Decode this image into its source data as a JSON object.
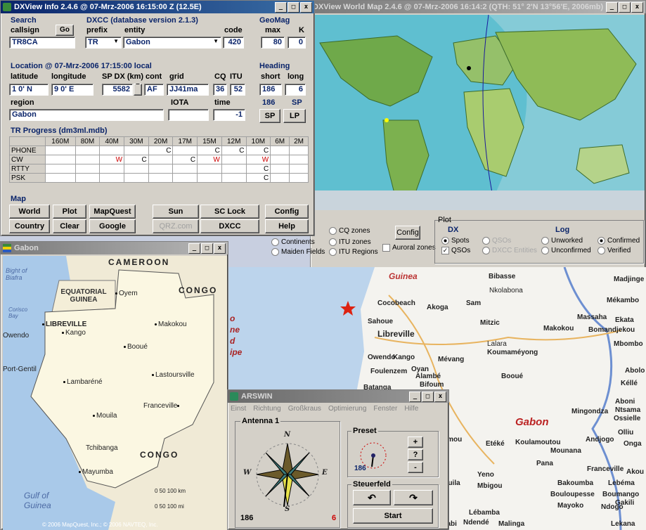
{
  "desktop": {
    "bg": "#c8cfe0"
  },
  "worldmap": {
    "title": "DXView World Map 2.4.6 @ 07-Mrz-2006 16:14:2  (QTH: 51° 2'N  13°56'E, 2006mb)",
    "options": {
      "continents": "Continents",
      "maiden_fields": "Maiden Fields",
      "cq_zones": "CQ zones",
      "itu_zones": "ITU zones",
      "itu_regions": "ITU Regions",
      "auroral_zones": "Auroral zones",
      "config_button": "Config"
    },
    "plot": {
      "group_label": "Plot",
      "dx_label": "DX",
      "spots": "Spots",
      "qsos": "QSOs",
      "qsos_dis": "QSOs",
      "dxcc_entities": "DXCC Entities",
      "log_label": "Log",
      "unworked": "Unworked",
      "unconfirmed": "Unconfirmed",
      "confirmed": "Confirmed",
      "verified": "Verified"
    }
  },
  "dxview": {
    "title": "DXView Info 2.4.6 @ 07-Mrz-2006 16:15:00 Z  (12.5E)",
    "search": {
      "group": "Search",
      "callsign_label": "callsign",
      "go": "Go",
      "callsign_value": "TR8CA"
    },
    "dxcc": {
      "group": "DXCC (database version 2.1.3)",
      "prefix_label": "prefix",
      "entity_label": "entity",
      "code_label": "code",
      "prefix_value": "TR",
      "entity_value": "Gabon",
      "code_value": "420"
    },
    "geomag": {
      "group": "GeoMag",
      "max_label": "max",
      "k_label": "K",
      "max_value": "80",
      "k_value": "0"
    },
    "location": {
      "group": "Location @ 07-Mrz-2006 17:15:00 local",
      "latitude_label": "latitude",
      "longitude_label": "longitude",
      "spdx_label": "SP DX (km)",
      "cont_label": "cont",
      "grid_label": "grid",
      "cq_label": "CQ",
      "itu_label": "ITU",
      "latitude_value": "1  0' N",
      "longitude_value": "9  0' E",
      "spdx_value": "5582",
      "cont_value": "AF",
      "grid_value": "JJ41ma",
      "cq_value": "36",
      "itu_value": "52",
      "region_label": "region",
      "iota_label": "IOTA",
      "time_label": "time",
      "region_value": "Gabon",
      "iota_value": "",
      "time_value": "-1"
    },
    "heading": {
      "group": "Heading",
      "short_label": "short",
      "long_label": "long",
      "short_value": "186",
      "long_value": "6",
      "sp_value": "186",
      "sp_text": "SP",
      "sp_button": "SP",
      "lp_button": "LP"
    },
    "progress": {
      "group": "TR Progress (dm3ml.mdb)",
      "bands": [
        "160M",
        "80M",
        "40M",
        "30M",
        "20M",
        "17M",
        "15M",
        "12M",
        "10M",
        "6M",
        "2M"
      ],
      "rows": [
        {
          "mode": "PHONE",
          "cells": [
            "",
            "",
            "",
            "",
            "C",
            "",
            "C",
            "C",
            "C",
            "",
            ""
          ]
        },
        {
          "mode": "CW",
          "cells": [
            "",
            "",
            "W",
            "C",
            "",
            "C",
            "W",
            "",
            "W",
            "",
            ""
          ]
        },
        {
          "mode": "RTTY",
          "cells": [
            "",
            "",
            "",
            "",
            "",
            "",
            "",
            "",
            "C",
            "",
            ""
          ]
        },
        {
          "mode": "PSK",
          "cells": [
            "",
            "",
            "",
            "",
            "",
            "",
            "",
            "",
            "C",
            "",
            ""
          ]
        }
      ]
    },
    "map": {
      "group": "Map",
      "buttons": [
        "World",
        "Plot",
        "MapQuest",
        "Sun",
        "SC Lock",
        "Config",
        "Country",
        "Clear",
        "Google",
        "QRZ.com",
        "DXCC",
        "Help"
      ]
    }
  },
  "gabonwin": {
    "title": "Gabon",
    "labels": {
      "cameroon": "CAMEROON",
      "congo_n": "CONGO",
      "congo_s": "CONGO",
      "eq_guinea": "EQUATORIAL GUINEA",
      "bight": "Bight of Biafra",
      "corisco": "Corisco Bay",
      "gulf": "Gulf of Guinea",
      "scale": "0    50   100 km",
      "scale2": "0      50      100 mi"
    },
    "cities": [
      "Oyem",
      "LIBREVILLE",
      "Kango",
      "Owendo",
      "Makokou",
      "Booué",
      "Port-Gentil",
      "Lambaréné",
      "Lastoursville",
      "Mouila",
      "Franceville",
      "Tchibanga",
      "Mayumba"
    ],
    "copyright": "© 2006 MapQuest, Inc.; © 2006 NAVTEQ, Inc."
  },
  "roadmap": {
    "labels": [
      "Guinea",
      "Bibasse",
      "Nkolabona",
      "Madjinge",
      "Cocobeach",
      "Akoga",
      "Sam",
      "Mékambo",
      "Mitzic",
      "Massaha",
      "Ekata",
      "Sahoue",
      "Libreville",
      "Makokou",
      "Bomandjekou",
      "Lalara",
      "Mbombo",
      "Owendo",
      "Kango",
      "Koumaméyong",
      "Mévang",
      "Foulenzem",
      "Oyan",
      "Alambé",
      "Booué",
      "Abolo",
      "Kéllé",
      "Batanga",
      "Bifoum",
      "Aboni",
      "Ntsama",
      "Ossielle",
      "Mingondza",
      "Gabon",
      "Olliu",
      "Mimou",
      "Etéké",
      "Koulamoutou",
      "Andjogo",
      "Onga",
      "Mounana",
      "Pana",
      "Franceville",
      "Akou",
      "Yeno",
      "Mouila",
      "Mbigou",
      "Bakoumba",
      "Lebéma",
      "Bouloupesse",
      "Boumango",
      "Mayoko",
      "Ndogo",
      "Gakili",
      "Lébamba",
      "Moabi",
      "Ndendé",
      "Malinga",
      "Lekana"
    ],
    "side_text": [
      "o",
      "ne",
      "d",
      "ipe"
    ]
  },
  "arswin": {
    "title": "ARSWIN",
    "menu": [
      "Einst",
      "Richtung",
      "Großkraus",
      "Optimierung",
      "Fenster",
      "Hilfe"
    ],
    "antenna_label": "Antenna 1",
    "heading_value": "186",
    "heading_red": "6",
    "preset_label": "Preset",
    "preset_value": "186",
    "plus": "+",
    "question": "?",
    "minus": "-",
    "steuerfeld_label": "Steuerfeld",
    "start_button": "Start",
    "compass": {
      "n": "N",
      "e": "E",
      "s": "S",
      "w": "W"
    }
  }
}
